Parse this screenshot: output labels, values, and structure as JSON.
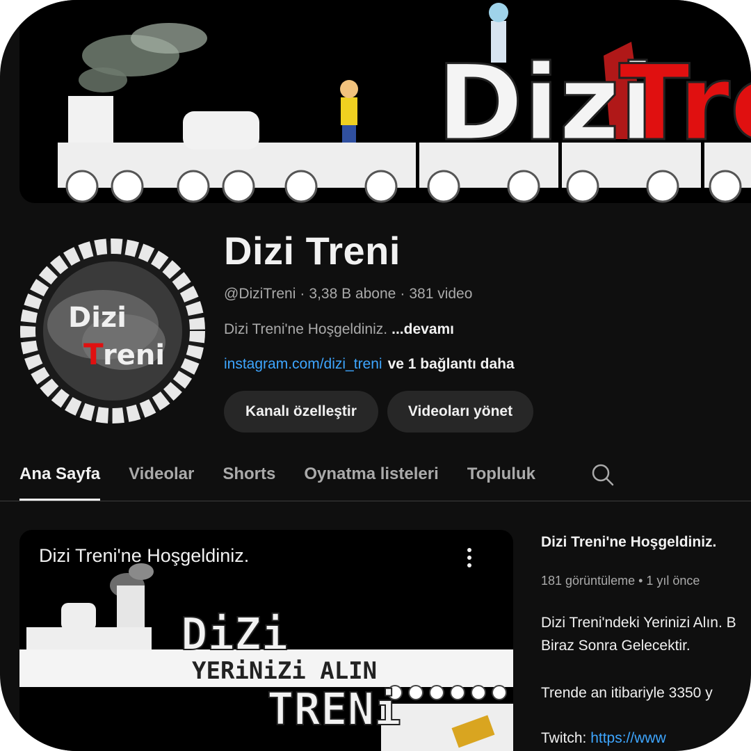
{
  "banner": {
    "title_part1": "Dizi",
    "title_part2": "Tre"
  },
  "avatar": {
    "text_line1": "Dizi",
    "text_line2_red": "T",
    "text_line2_rest": "reni"
  },
  "channel": {
    "title": "Dizi Treni",
    "handle": "@DiziTreni",
    "subscribers": "3,38 B abone",
    "videos": "381 video",
    "separator": "·",
    "description": "Dizi Treni'ne Hoşgeldiniz.",
    "more_label": "...devamı",
    "link": "instagram.com/dizi_treni",
    "more_links": "ve 1 bağlantı daha"
  },
  "buttons": {
    "customize": "Kanalı özelleştir",
    "manage": "Videoları yönet"
  },
  "tabs": [
    {
      "label": "Ana Sayfa",
      "active": true
    },
    {
      "label": "Videolar",
      "active": false
    },
    {
      "label": "Shorts",
      "active": false
    },
    {
      "label": "Oynatma listeleri",
      "active": false
    },
    {
      "label": "Topluluk",
      "active": false
    }
  ],
  "featured": {
    "player_title": "Dizi Treni'ne Hoşgeldiniz.",
    "art_word_top": "DiZi",
    "art_slogan": "YERiNiZi ALIN",
    "art_word_bottom": "TRENi",
    "title": "Dizi Treni'ne Hoşgeldiniz.",
    "stats": "181 görüntüleme • 1 yıl önce",
    "desc_line1": "Dizi Treni'ndeki Yerinizi Alın. B",
    "desc_line2": "Biraz Sonra Gelecektir.",
    "desc_line3": "Trende an itibariyle 3350 y",
    "desc_line4_prefix": "Twitch:",
    "desc_line4_link": "https://www"
  },
  "colors": {
    "background": "#0f0f0f",
    "accent_link": "#3ea6ff",
    "pill_bg": "#272727",
    "brand_red": "#e01010"
  },
  "icons": {
    "search": "search-icon",
    "menu": "more-vert-icon"
  }
}
